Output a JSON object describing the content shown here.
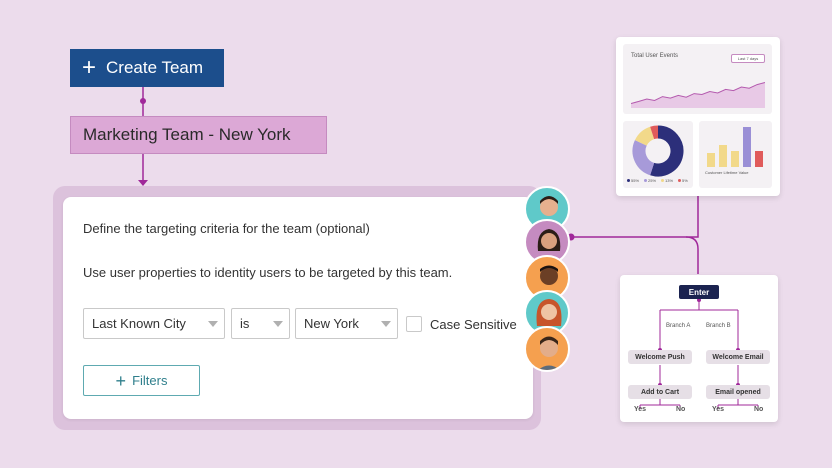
{
  "create_team": {
    "label": "Create Team"
  },
  "team_name": "Marketing Team - New York",
  "targeting": {
    "title": "Define the targeting criteria for the team (optional)",
    "description": "Use user properties to identity users to be targeted by this team.",
    "property_select": "Last Known City",
    "operator_select": "is",
    "value_select": "New York",
    "case_sensitive_label": "Case Sensitive",
    "filters_label": "Filters"
  },
  "events_panel": {
    "title": "Total User Events",
    "range_select": "Last 7 days",
    "line_chart": [
      0.15,
      0.22,
      0.3,
      0.25,
      0.38,
      0.33,
      0.42,
      0.36,
      0.48,
      0.45,
      0.55,
      0.5,
      0.62,
      0.58,
      0.7,
      0.66,
      0.78,
      0.85
    ],
    "donut": [
      {
        "value": 55,
        "color": "#2c2f7a"
      },
      {
        "value": 27,
        "color": "#a79ad9"
      },
      {
        "value": 13,
        "color": "#f2d98a"
      },
      {
        "value": 5,
        "color": "#e05b5b"
      }
    ],
    "donut_legend": [
      "55%",
      "25%",
      "13%",
      "5%"
    ],
    "bars": [
      {
        "value": 0.35,
        "color": "#f2d98a"
      },
      {
        "value": 0.55,
        "color": "#f2d98a"
      },
      {
        "value": 0.4,
        "color": "#f2d98a"
      },
      {
        "value": 1.0,
        "color": "#9a8fd6"
      },
      {
        "value": 0.4,
        "color": "#e05b5b"
      }
    ],
    "bar_caption": "Customer Lifetime Value"
  },
  "flow": {
    "enter": "Enter",
    "branch_a": "Branch A",
    "branch_b": "Branch B",
    "left_step": "Welcome Push",
    "right_step": "Welcome Email",
    "left_event": "Add to Cart",
    "right_event": "Email opened",
    "yes": "Yes",
    "no": "No"
  },
  "colors": {
    "primary": "#1c4e8c",
    "accent": "#a0289a",
    "team_bg": "#dca8d6"
  }
}
